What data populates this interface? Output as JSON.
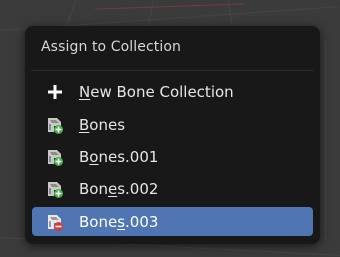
{
  "menu": {
    "title": "Assign to Collection",
    "items": [
      {
        "pre": "",
        "ul": "N",
        "post": "ew Bone Collection",
        "icon": "plus-icon",
        "selected": false
      },
      {
        "pre": "",
        "ul": "B",
        "post": "ones",
        "icon": "bone-collection-green-icon",
        "selected": false
      },
      {
        "pre": "B",
        "ul": "o",
        "post": "nes.001",
        "icon": "bone-collection-green-icon",
        "selected": false
      },
      {
        "pre": "Bon",
        "ul": "e",
        "post": "s.002",
        "icon": "bone-collection-green-icon",
        "selected": false
      },
      {
        "pre": "Bone",
        "ul": "s",
        "post": ".003",
        "icon": "bone-collection-red-icon",
        "selected": true
      }
    ]
  },
  "colors": {
    "menu_bg": "#181818",
    "highlight": "#4f76b3",
    "green_badge": "#3cb043",
    "red_badge": "#d83a3a"
  }
}
